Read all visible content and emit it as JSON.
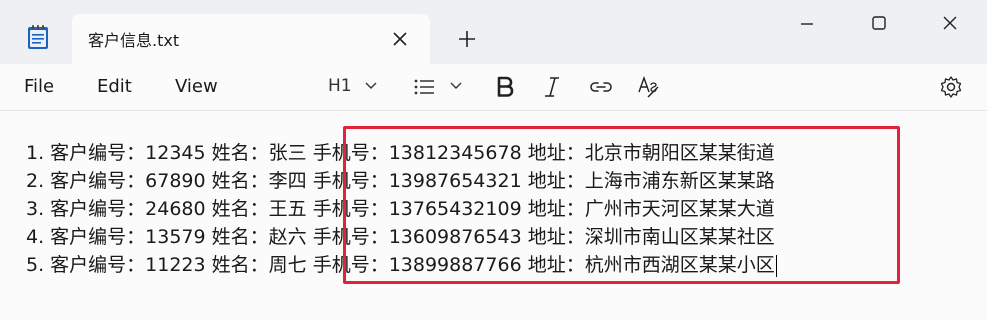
{
  "tab": {
    "title": "客户信息.txt"
  },
  "menu": {
    "file": "File",
    "edit": "Edit",
    "view": "View"
  },
  "toolbar": {
    "heading": "H1"
  },
  "icons": {
    "app": "notepad-icon",
    "close": "close-icon",
    "add": "plus-icon",
    "minimize": "minimize-icon",
    "maximize": "maximize-icon",
    "window_close": "window-close-icon",
    "list": "list-icon",
    "bold": "bold-icon",
    "italic": "italic-icon",
    "link": "link-icon",
    "clear_format": "clear-format-icon",
    "settings": "gear-icon"
  },
  "colors": {
    "highlight": "#e0233a"
  },
  "document": {
    "lines": [
      "1. 客户编号：12345 姓名：张三 手机号：13812345678 地址：北京市朝阳区某某街道",
      "2. 客户编号：67890 姓名：李四 手机号：13987654321 地址：上海市浦东新区某某路",
      "3. 客户编号：24680 姓名：王五 手机号：13765432109 地址：广州市天河区某某大道",
      "4. 客户编号：13579 姓名：赵六 手机号：13609876543 地址：深圳市南山区某某社区",
      "5. 客户编号：11223 姓名：周七 手机号：13899887766 地址：杭州市西湖区某某小区"
    ]
  }
}
